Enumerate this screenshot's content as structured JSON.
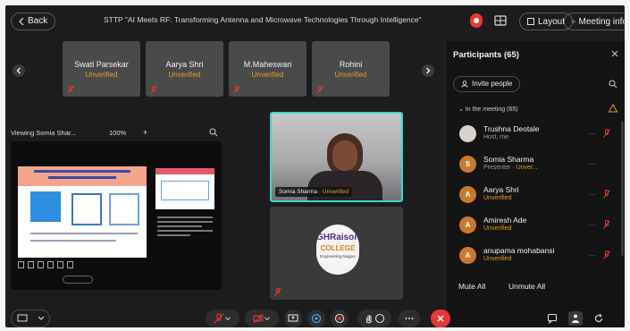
{
  "header": {
    "back_label": "Back",
    "title": "STTP \"AI Meets RF: Transforming Antenna and Microwave Technologies Through Intelligence\"",
    "layout_label": "Layout",
    "meeting_info_label": "Meeting info"
  },
  "thumbnails": [
    {
      "name": "Swati Parsekar",
      "status": "Unverified"
    },
    {
      "name": "Aarya Shri",
      "status": "Unverified"
    },
    {
      "name": "M.Maheswari",
      "status": "Unverified"
    },
    {
      "name": "Rohini",
      "status": "Unverified"
    }
  ],
  "share": {
    "viewing_label": "Viewing Somia Shar...",
    "zoom": "100%",
    "plus": "+"
  },
  "video": {
    "name": "Somia Sharma",
    "status": "Unverified"
  },
  "college_logo": {
    "line1": "GHRaisoni",
    "line2": "COLLEGE",
    "line3": "Engineering Nagpur"
  },
  "participants_panel": {
    "title": "Participants (65)",
    "invite_label": "Invite people",
    "section_label": "In the meeting (65)",
    "participants": [
      {
        "name": "Trushna Deotale",
        "sub": "Host, me",
        "avatar": "photo"
      },
      {
        "name": "Somia Sharma",
        "sub": "Presenter",
        "sub2": "Unver...",
        "avatar": "S"
      },
      {
        "name": "Aarya Shri",
        "sub": "",
        "sub2": "Unverified",
        "avatar": "A"
      },
      {
        "name": "Amiresh Ade",
        "sub": "",
        "sub2": "Unverified",
        "avatar": "A"
      },
      {
        "name": "anupama mohabansi",
        "sub": "",
        "sub2": "Unverified",
        "avatar": "A"
      }
    ],
    "mute_all_label": "Mute All",
    "unmute_all_label": "Unmute All"
  },
  "colors": {
    "accent_teal": "#3fd6c8",
    "unverified": "#e0a020",
    "end_call": "#e53935",
    "background": "#1c1c1c"
  }
}
